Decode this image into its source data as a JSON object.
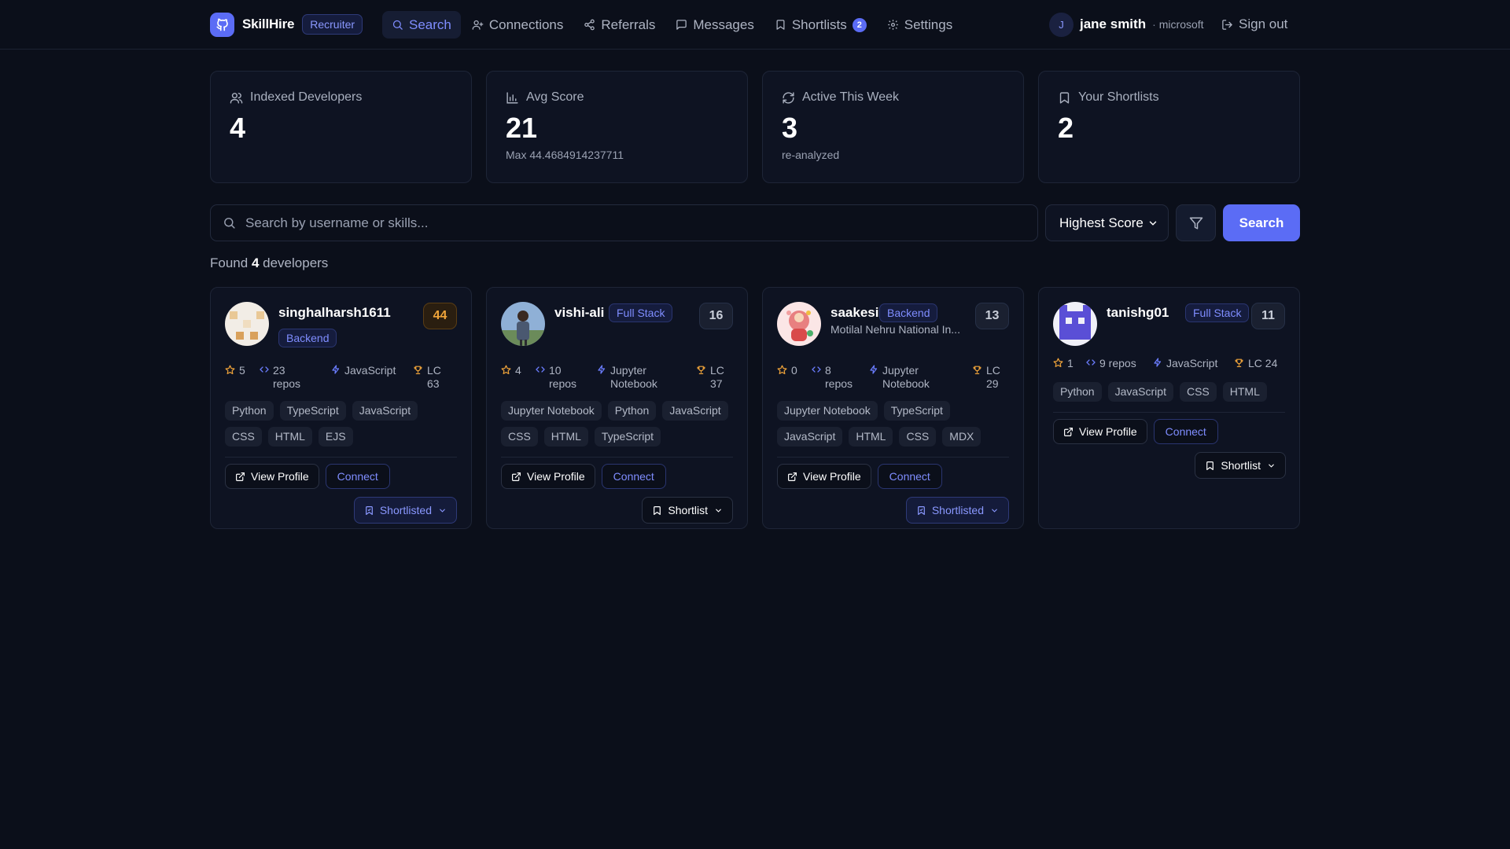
{
  "app": {
    "name": "SkillHire",
    "role_badge": "Recruiter"
  },
  "nav": {
    "search": "Search",
    "connections": "Connections",
    "referrals": "Referrals",
    "messages": "Messages",
    "shortlists": "Shortlists",
    "shortlists_count": "2",
    "settings": "Settings"
  },
  "user": {
    "initial": "J",
    "name": "jane smith",
    "separator": "·",
    "company": "microsoft",
    "signout": "Sign out"
  },
  "stats": [
    {
      "label": "Indexed Developers",
      "value": "4",
      "sub": "",
      "icon": "users-icon"
    },
    {
      "label": "Avg Score",
      "value": "21",
      "sub": "Max 44.4684914237711",
      "icon": "bar-chart-icon"
    },
    {
      "label": "Active This Week",
      "value": "3",
      "sub": "re-analyzed",
      "icon": "refresh-icon"
    },
    {
      "label": "Your Shortlists",
      "value": "2",
      "sub": "",
      "icon": "bookmark-icon"
    }
  ],
  "search": {
    "placeholder": "Search by username or skills...",
    "value": "",
    "sort": "Highest Score",
    "button": "Search"
  },
  "results": {
    "prefix": "Found",
    "count": "4",
    "suffix": "developers"
  },
  "colors": {
    "accent": "#5b6cf5",
    "score_high": "#f0a43a",
    "background": "#0b0f1a"
  },
  "cards": [
    {
      "username": "singhalharsh1611",
      "role": "Backend",
      "subtitle": "",
      "score": "44",
      "stars": "5",
      "repos": "23 repos",
      "language": "JavaScript",
      "lc": "LC 63",
      "tags": [
        "Python",
        "TypeScript",
        "JavaScript",
        "CSS",
        "HTML",
        "EJS"
      ],
      "view": "View Profile",
      "connect": "Connect",
      "shortlist": "Shortlisted"
    },
    {
      "username": "vishi-ali",
      "role": "Full Stack",
      "subtitle": "",
      "score": "16",
      "stars": "4",
      "repos": "10 repos",
      "language": "Jupyter Notebook",
      "lc": "LC 37",
      "tags": [
        "Jupyter Notebook",
        "Python",
        "JavaScript",
        "CSS",
        "HTML",
        "TypeScript"
      ],
      "view": "View Profile",
      "connect": "Connect",
      "shortlist": "Shortlist"
    },
    {
      "username": "saakesi",
      "role": "Backend",
      "subtitle": "Motilal Nehru National In...",
      "score": "13",
      "stars": "0",
      "repos": "8 repos",
      "language": "Jupyter Notebook",
      "lc": "LC 29",
      "tags": [
        "Jupyter Notebook",
        "TypeScript",
        "JavaScript",
        "HTML",
        "CSS",
        "MDX"
      ],
      "view": "View Profile",
      "connect": "Connect",
      "shortlist": "Shortlisted"
    },
    {
      "username": "tanishg01",
      "role": "Full Stack",
      "subtitle": "",
      "score": "11",
      "stars": "1",
      "repos": "9 repos",
      "language": "JavaScript",
      "lc": "LC 24",
      "tags": [
        "Python",
        "JavaScript",
        "CSS",
        "HTML"
      ],
      "view": "View Profile",
      "connect": "Connect",
      "shortlist": "Shortlist"
    }
  ]
}
